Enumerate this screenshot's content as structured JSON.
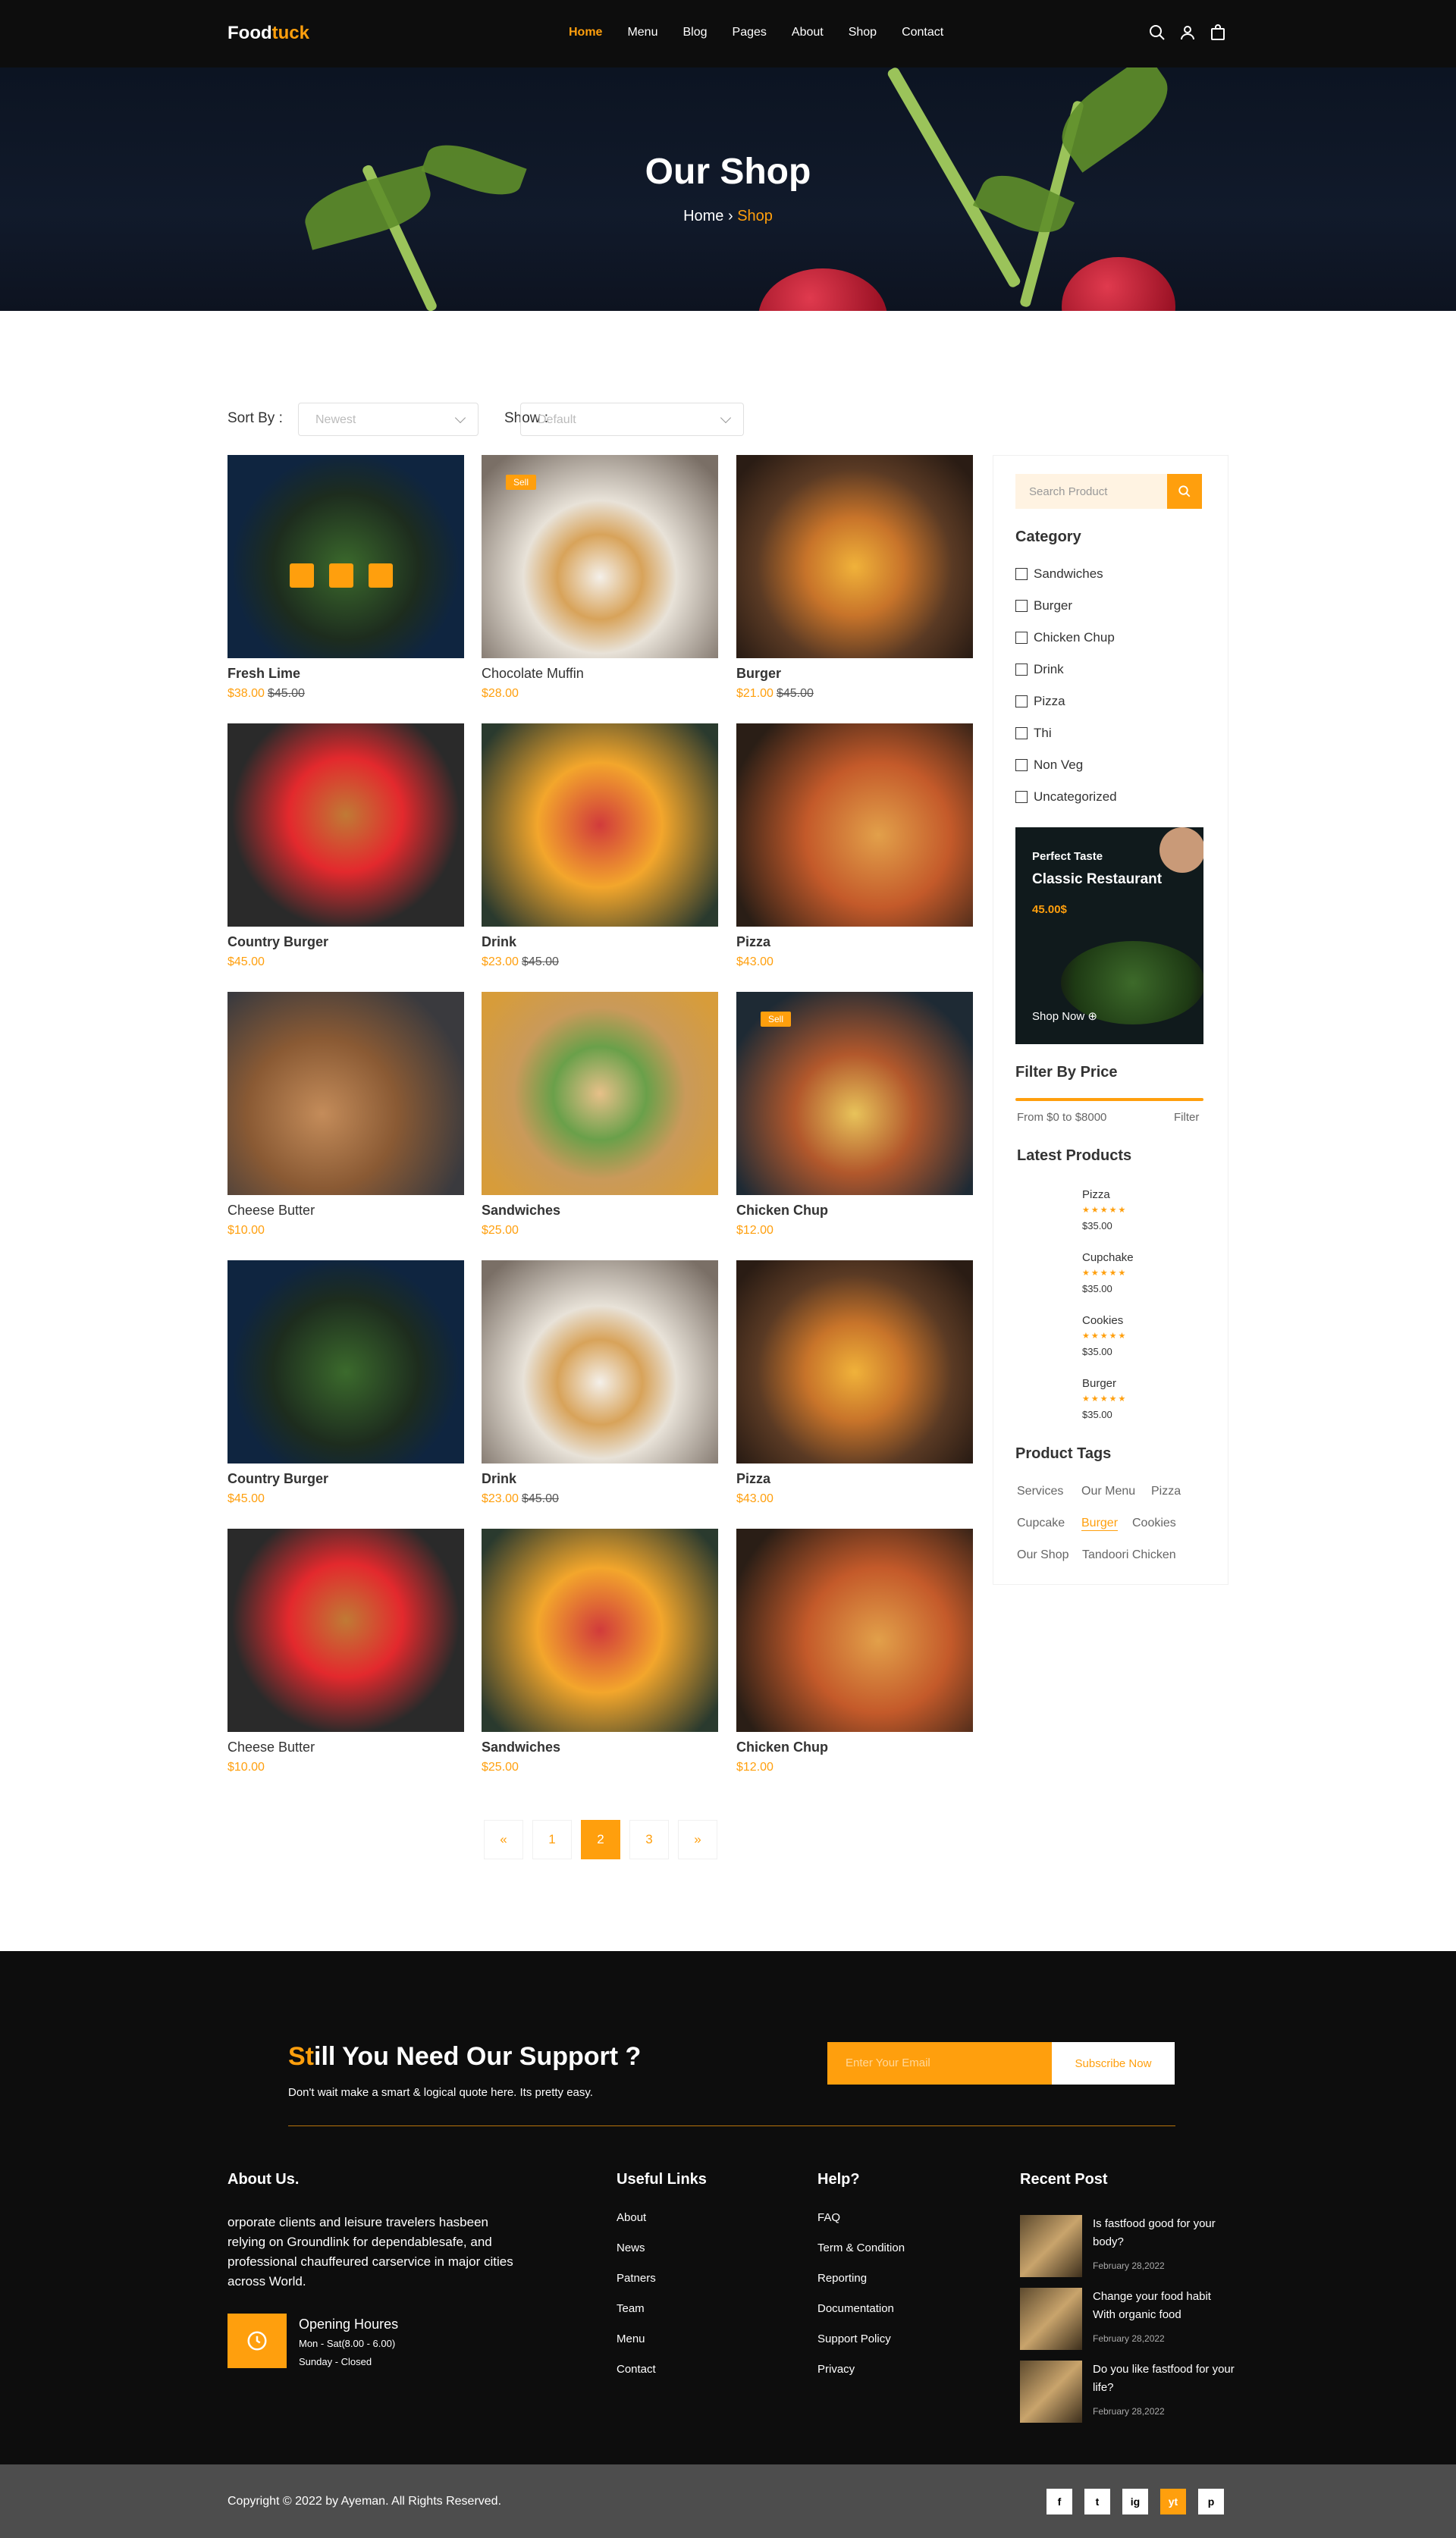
{
  "header": {
    "logo_a": "Food",
    "logo_b": "tuck",
    "nav": [
      "Home",
      "Menu",
      "Blog",
      "Pages",
      "About",
      "Shop",
      "Contact"
    ],
    "active_nav": "Home"
  },
  "hero": {
    "title": "Our Shop",
    "crumb_home": "Home",
    "crumb_sep": "›",
    "crumb_current": "Shop"
  },
  "filters": {
    "sort_label": "Sort By :",
    "sort_value": "Newest",
    "show_label": "Show :",
    "show_value": "Default"
  },
  "products": [
    {
      "name": "Fresh Lime",
      "bold": true,
      "price": "$38.00",
      "old": "$45.00",
      "sell": false
    },
    {
      "name": "Chocolate Muffin",
      "bold": false,
      "price": "$28.00",
      "old": "",
      "sell": true
    },
    {
      "name": "Burger",
      "bold": true,
      "price": "$21.00",
      "old": "$45.00",
      "sell": false
    },
    {
      "name": "Country Burger",
      "bold": true,
      "price": "$45.00",
      "old": "",
      "sell": false
    },
    {
      "name": "Drink",
      "bold": true,
      "price": "$23.00",
      "old": "$45.00",
      "sell": false
    },
    {
      "name": "Pizza",
      "bold": true,
      "price": "$43.00",
      "old": "",
      "sell": false
    },
    {
      "name": "Cheese Butter",
      "bold": false,
      "price": "$10.00",
      "old": "",
      "sell": false
    },
    {
      "name": "Sandwiches",
      "bold": true,
      "price": "$25.00",
      "old": "",
      "sell": false
    },
    {
      "name": "Chicken Chup",
      "bold": true,
      "price": "$12.00",
      "old": "",
      "sell": true
    },
    {
      "name": "Country Burger",
      "bold": true,
      "price": "$45.00",
      "old": "",
      "sell": false
    },
    {
      "name": "Drink",
      "bold": true,
      "price": "$23.00",
      "old": "$45.00",
      "sell": false
    },
    {
      "name": "Pizza",
      "bold": true,
      "price": "$43.00",
      "old": "",
      "sell": false
    },
    {
      "name": "Cheese Butter",
      "bold": false,
      "price": "$10.00",
      "old": "",
      "sell": false
    },
    {
      "name": "Sandwiches",
      "bold": true,
      "price": "$25.00",
      "old": "",
      "sell": false
    },
    {
      "name": "Chicken Chup",
      "bold": true,
      "price": "$12.00",
      "old": "",
      "sell": false
    }
  ],
  "sell_badge": "Sell",
  "sidebar": {
    "search_placeholder": "Search Product",
    "category_title": "Category",
    "categories": [
      "Sandwiches",
      "Burger",
      "Chicken Chup",
      "Drink",
      "Pizza",
      "Thi",
      "Non Veg",
      "Uncategorized"
    ],
    "banner": {
      "kicker": "Perfect Taste",
      "title": "Classic Restaurant",
      "price": "45.00$",
      "cta": "Shop Now"
    },
    "filter_title": "Filter By Price",
    "filter_range": "From $0 to $8000",
    "filter_btn": "Filter",
    "latest_title": "Latest Products",
    "latest": [
      {
        "name": "Pizza",
        "stars": "★★★★★",
        "price": "$35.00"
      },
      {
        "name": "Cupchake",
        "stars": "★★★★★",
        "price": "$35.00"
      },
      {
        "name": "Cookies",
        "stars": "★★★★★",
        "price": "$35.00"
      },
      {
        "name": "Burger",
        "stars": "★★★★★",
        "price": "$35.00"
      }
    ],
    "tags_title": "Product Tags",
    "tags": [
      "Services",
      "Our Menu",
      "Pizza",
      "Cupcake",
      "Burger",
      "Cookies",
      "Our Shop",
      "Tandoori Chicken"
    ],
    "active_tag": "Burger"
  },
  "pagination": [
    "«",
    "1",
    "2",
    "3",
    "»"
  ],
  "pagination_active": "2",
  "footer": {
    "support_a": "St",
    "support_b": "ill You Need Our Support ?",
    "support_sub": "Don't wait make a smart & logical quote here. Its pretty easy.",
    "email_placeholder": "Enter Your Email",
    "subscribe": "Subscribe Now",
    "about_title": "About Us.",
    "about_text": "orporate clients and leisure travelers hasbeen relying on Groundlink for dependablesafe, and professional chauffeured carservice in major cities across World.",
    "hours_title": "Opening Houres",
    "hours_1": "Mon - Sat(8.00 - 6.00)",
    "hours_2": "Sunday - Closed",
    "useful_title": "Useful Links",
    "useful": [
      "About",
      "News",
      "Patners",
      "Team",
      "Menu",
      "Contact"
    ],
    "help_title": "Help?",
    "help": [
      "FAQ",
      "Term & Condition",
      "Reporting",
      "Documentation",
      "Support Policy",
      "Privacy"
    ],
    "recent_title": "Recent Post",
    "recent": [
      {
        "title": "Is fastfood good for your body?",
        "date": "February 28,2022"
      },
      {
        "title": "Change your food habit With organic food",
        "date": "February 28,2022"
      },
      {
        "title": "Do you like fastfood for your life?",
        "date": "February 28,2022"
      }
    ],
    "copyright": "Copyright © 2022 by Ayeman. All Rights Reserved.",
    "social": [
      "f",
      "t",
      "ig",
      "yt",
      "p"
    ]
  }
}
